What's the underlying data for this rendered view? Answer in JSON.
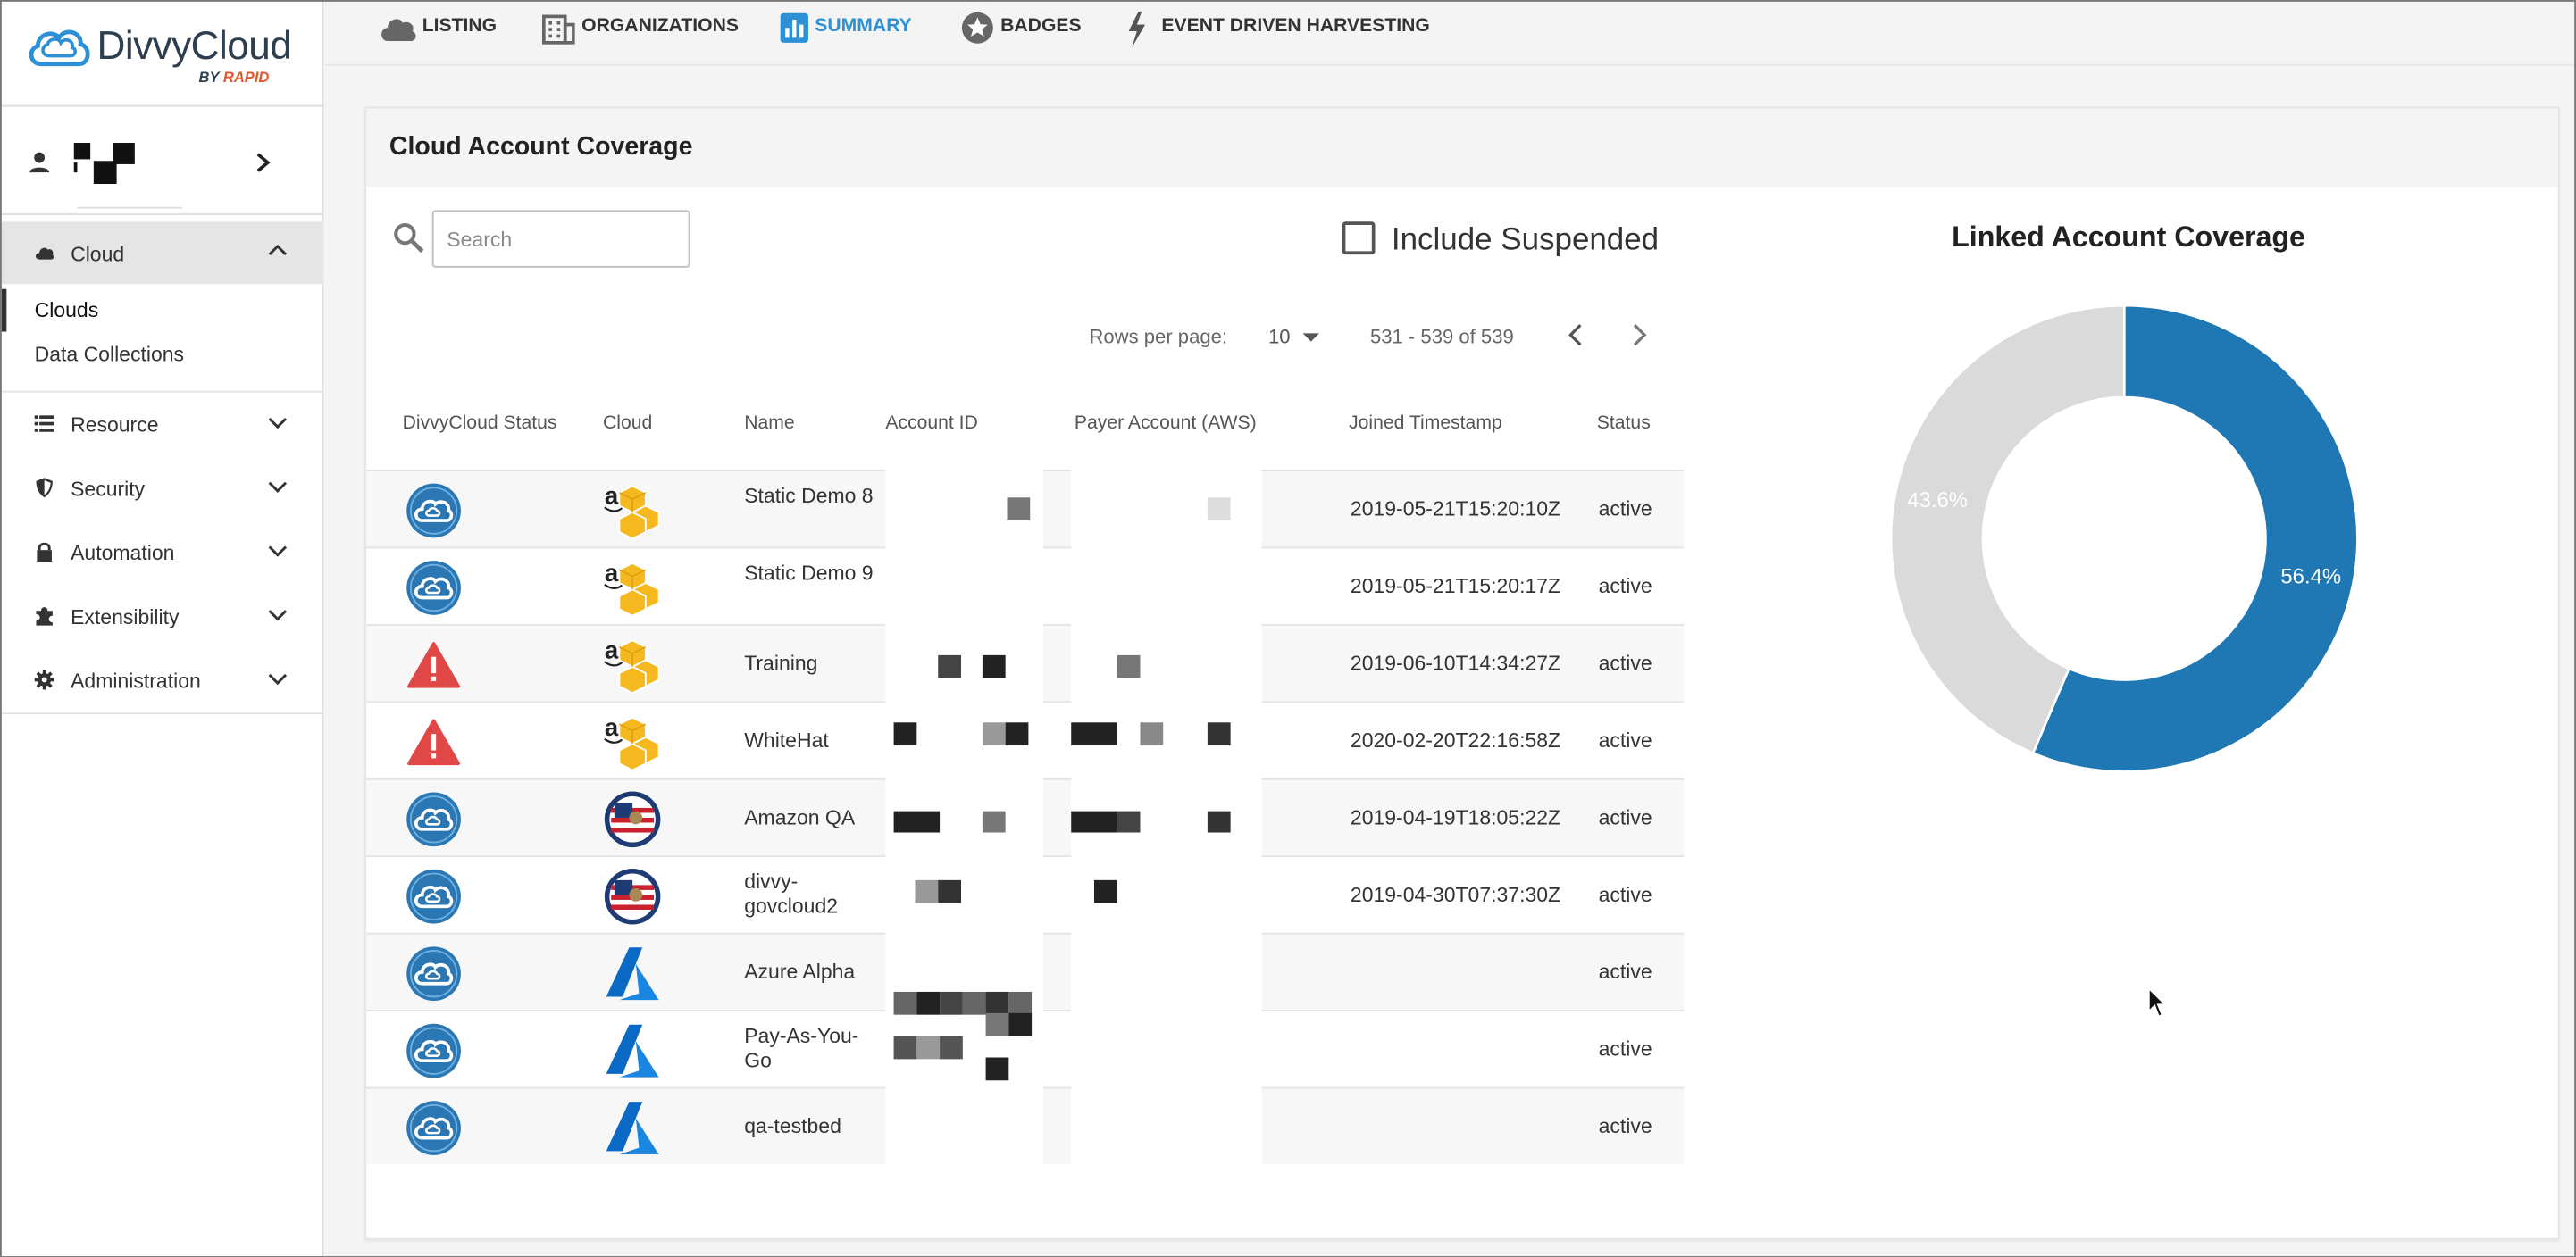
{
  "brand": {
    "name": "DivvyCloud",
    "by": "BY",
    "by_brand": "RAPID"
  },
  "sidebar": {
    "sections": [
      {
        "label": "Cloud",
        "icon": "cloud-icon",
        "expanded": true,
        "children": [
          "Clouds",
          "Data Collections"
        ],
        "active_child": "Clouds"
      },
      {
        "label": "Resource",
        "icon": "list-icon"
      },
      {
        "label": "Security",
        "icon": "shield-icon"
      },
      {
        "label": "Automation",
        "icon": "lock-icon"
      },
      {
        "label": "Extensibility",
        "icon": "puzzle-icon"
      },
      {
        "label": "Administration",
        "icon": "gear-icon"
      }
    ]
  },
  "topnav": {
    "tabs": [
      {
        "label": "LISTING",
        "icon": "cloud-icon"
      },
      {
        "label": "ORGANIZATIONS",
        "icon": "building-icon"
      },
      {
        "label": "SUMMARY",
        "icon": "bar-chart-icon",
        "active": true
      },
      {
        "label": "BADGES",
        "icon": "star-badge-icon"
      },
      {
        "label": "EVENT DRIVEN HARVESTING",
        "icon": "lightning-icon"
      }
    ]
  },
  "card": {
    "title": "Cloud Account Coverage",
    "search": {
      "placeholder": "Search",
      "value": ""
    },
    "include_suspended": {
      "label": "Include Suspended",
      "checked": false
    },
    "pagination": {
      "rows_label": "Rows per page:",
      "rows_value": "10",
      "range": "531 - 539 of 539"
    },
    "columns": [
      "DivvyCloud Status",
      "Cloud",
      "Name",
      "Account ID",
      "Payer Account (AWS)",
      "Joined Timestamp",
      "Status"
    ],
    "rows": [
      {
        "status_icon": "divvycloud-ok-icon",
        "cloud": "aws-icon",
        "name": "Static Demo 8",
        "joined": "2019-05-21T15:20:10Z",
        "status": "active"
      },
      {
        "status_icon": "divvycloud-ok-icon",
        "cloud": "aws-icon",
        "name": "Static Demo 9",
        "joined": "2019-05-21T15:20:17Z",
        "status": "active"
      },
      {
        "status_icon": "warning-icon",
        "cloud": "aws-icon",
        "name": "Training",
        "joined": "2019-06-10T14:34:27Z",
        "status": "active"
      },
      {
        "status_icon": "warning-icon",
        "cloud": "aws-icon",
        "name": "WhiteHat",
        "joined": "2020-02-20T22:16:58Z",
        "status": "active"
      },
      {
        "status_icon": "divvycloud-ok-icon",
        "cloud": "govcloud-icon",
        "name": "Amazon QA",
        "joined": "2019-04-19T18:05:22Z",
        "status": "active"
      },
      {
        "status_icon": "divvycloud-ok-icon",
        "cloud": "govcloud-icon",
        "name": "divvy-govcloud2",
        "joined": "2019-04-30T07:37:30Z",
        "status": "active"
      },
      {
        "status_icon": "divvycloud-ok-icon",
        "cloud": "azure-icon",
        "name": "Azure Alpha",
        "joined": "",
        "status": "active"
      },
      {
        "status_icon": "divvycloud-ok-icon",
        "cloud": "azure-icon",
        "name": "Pay-As-You-Go",
        "joined": "",
        "status": "active"
      },
      {
        "status_icon": "divvycloud-ok-icon",
        "cloud": "azure-icon",
        "name": "qa-testbed",
        "joined": "",
        "status": "active"
      }
    ]
  },
  "chart_data": {
    "type": "pie",
    "variant": "donut",
    "title": "Linked Account Coverage",
    "slices": [
      {
        "label": "56.4%",
        "value": 56.4,
        "color": "#1f78b4"
      },
      {
        "label": "43.6%",
        "value": 43.6,
        "color": "#dadada"
      }
    ]
  },
  "colors": {
    "accent": "#2d8fd5",
    "donut_blue": "#1f78b4",
    "donut_grey": "#dadada",
    "warning": "#e04848"
  }
}
